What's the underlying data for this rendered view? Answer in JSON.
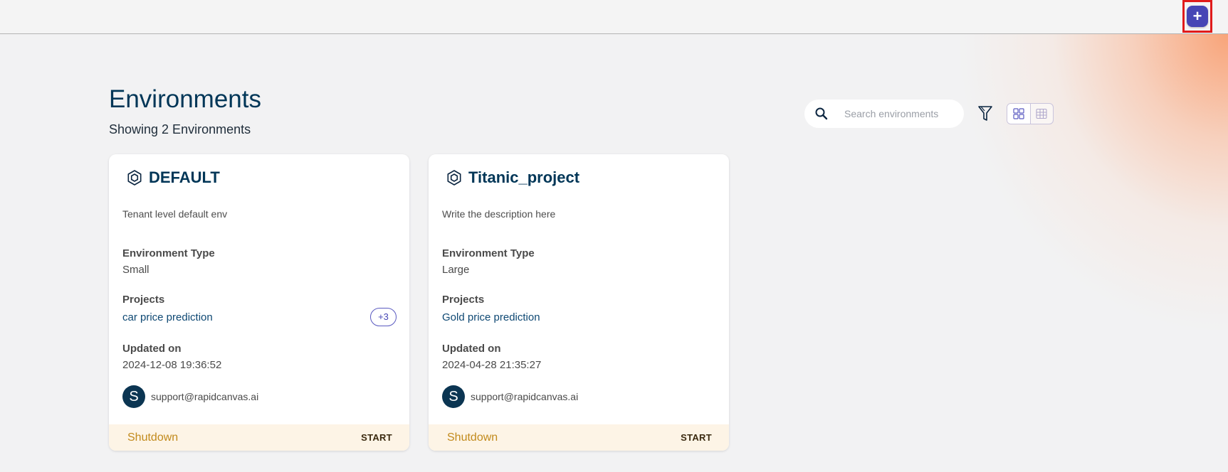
{
  "topbar": {
    "add_button_label": "+"
  },
  "page": {
    "title": "Environments",
    "subtitle": "Showing 2 Environments"
  },
  "search": {
    "placeholder": "Search environments",
    "value": ""
  },
  "colors": {
    "accent": "#4646b5",
    "title": "#003657",
    "status_shutdown": "#c28a1c",
    "footer_bg": "#fdf4e6",
    "highlight_border": "#e01b1b"
  },
  "icons": {
    "add": "plus-icon",
    "search": "search-icon",
    "filter": "filter-icon",
    "grid_view": "grid-view-icon",
    "table_view": "table-view-icon",
    "environment": "hexagon-icon"
  },
  "environments": [
    {
      "name": "DEFAULT",
      "description": "Tenant level default env",
      "type_label": "Environment Type",
      "type_value": "Small",
      "projects_label": "Projects",
      "project": "car price prediction",
      "more_projects": "+3",
      "updated_label": "Updated on",
      "updated_value": "2024-12-08 19:36:52",
      "owner_initial": "S",
      "owner_email": "support@rapidcanvas.ai",
      "status": "Shutdown",
      "action": "START"
    },
    {
      "name": "Titanic_project",
      "description": "Write the description here",
      "type_label": "Environment Type",
      "type_value": "Large",
      "projects_label": "Projects",
      "project": "Gold price prediction",
      "updated_label": "Updated on",
      "updated_value": "2024-04-28 21:35:27",
      "owner_initial": "S",
      "owner_email": "support@rapidcanvas.ai",
      "status": "Shutdown",
      "action": "START"
    }
  ]
}
